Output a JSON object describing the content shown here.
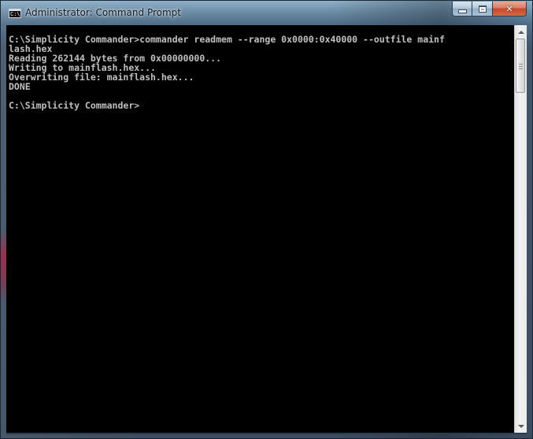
{
  "window": {
    "title": "Administrator: Command Prompt",
    "icon_text": "C:\\"
  },
  "caption_buttons": {
    "close_symbol": "✕"
  },
  "console": {
    "lines": [
      "C:\\Simplicity Commander>commander readmem --range 0x0000:0x40000 --outfile mainf",
      "lash.hex",
      "Reading 262144 bytes from 0x00000000...",
      "Writing to mainflash.hex...",
      "Overwriting file: mainflash.hex...",
      "DONE",
      "",
      "C:\\Simplicity Commander>"
    ]
  },
  "colors": {
    "console_background": "#000000",
    "console_text": "#c0c0c0",
    "close_button": "#c7462a"
  }
}
